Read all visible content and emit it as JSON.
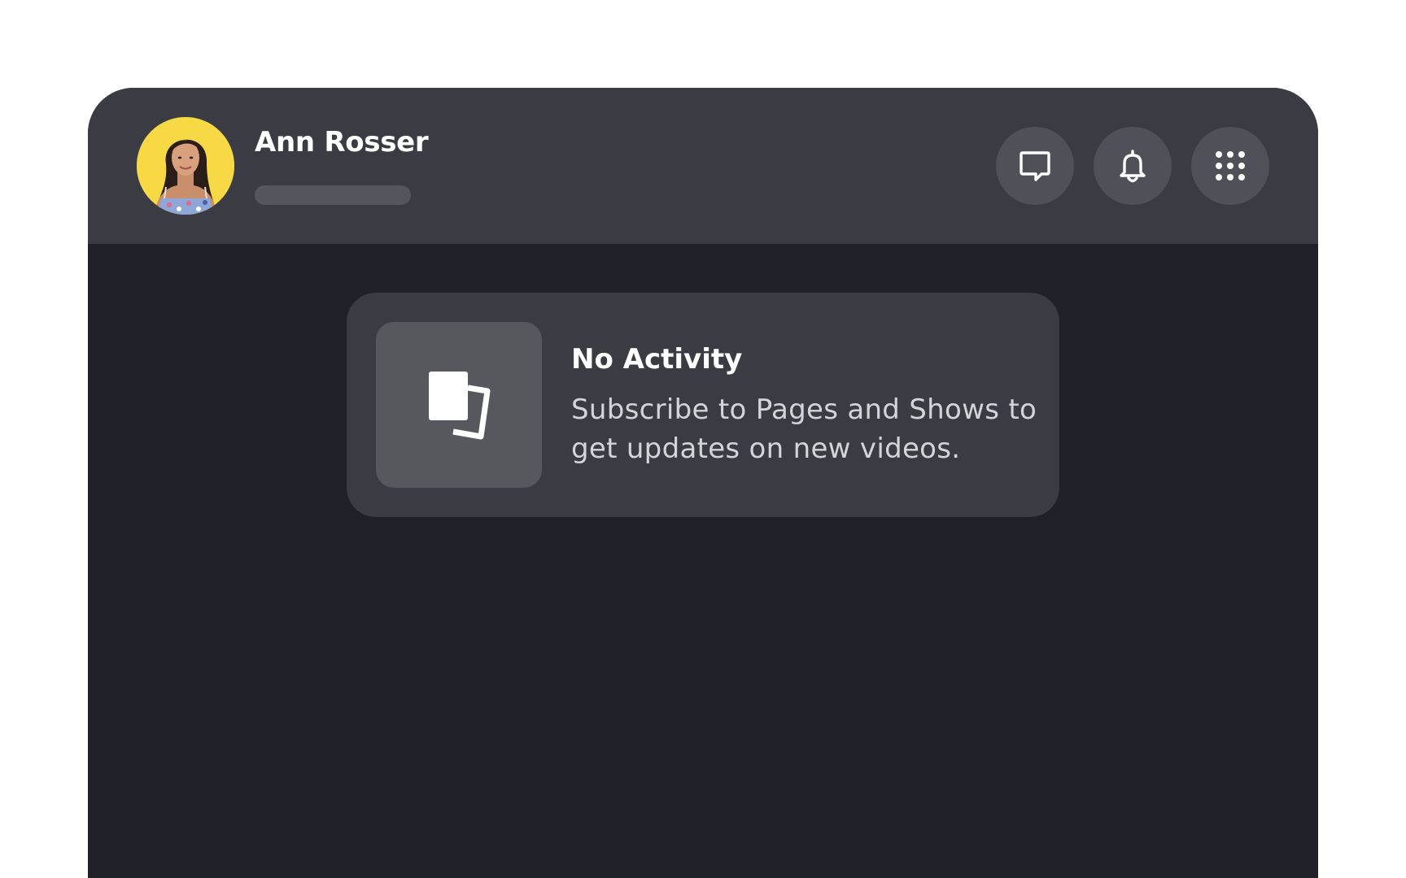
{
  "profile": {
    "name": "Ann Rosser",
    "avatar_icon": "user-photo-avatar",
    "avatar_bg": "#f6d944"
  },
  "header": {
    "buttons": [
      {
        "icon": "chat-bubble-icon"
      },
      {
        "icon": "bell-icon"
      },
      {
        "icon": "grid-menu-icon"
      }
    ]
  },
  "empty_state": {
    "icon": "pages-stack-icon",
    "title": "No Activity",
    "description": "Subscribe to Pages and Shows to get updates on new videos."
  },
  "colors": {
    "page_bg": "#ffffff",
    "frame_bg": "#202028",
    "header_bg": "#3a3b43",
    "card_bg": "#3a3b43",
    "button_bg": "#505158",
    "text_primary": "#ffffff",
    "text_secondary": "#d4d5d9"
  }
}
